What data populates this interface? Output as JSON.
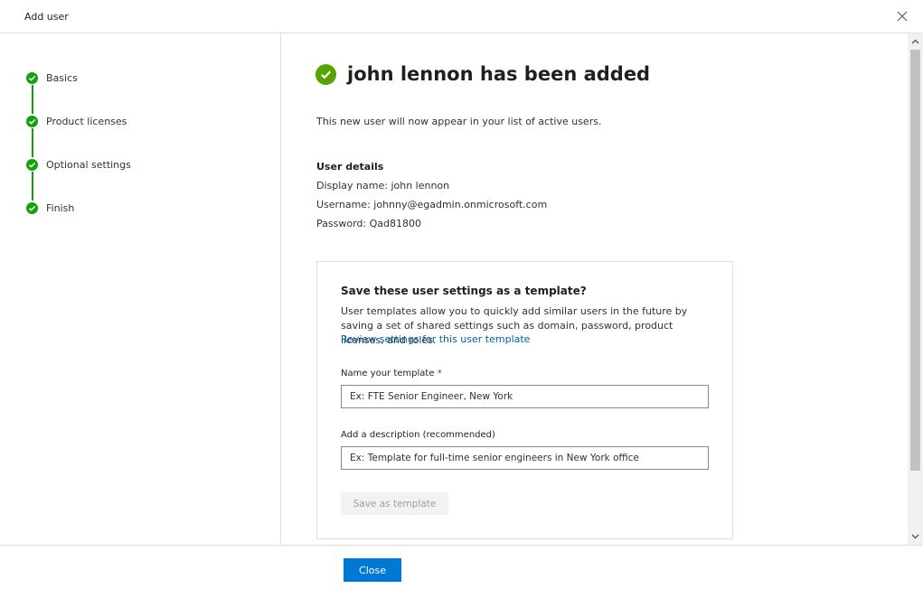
{
  "window": {
    "title": "Add user"
  },
  "steps": [
    {
      "label": "Basics"
    },
    {
      "label": "Product licenses"
    },
    {
      "label": "Optional settings"
    },
    {
      "label": "Finish"
    }
  ],
  "main": {
    "heading": "john lennon has been added",
    "intro": "This new user will now appear in your list of active users.",
    "details_title": "User details",
    "details": [
      "Display name: john lennon",
      "Username: johnny@egadmin.onmicrosoft.com",
      "Password: Qad81800"
    ]
  },
  "template_card": {
    "title": "Save these user settings as a template?",
    "body": "User templates allow you to quickly add similar users in the future by saving a set of shared settings such as domain, password, product licenses, and roles.",
    "link": "Review settings for this user template",
    "name_label": "Name your template",
    "required_mark": "*",
    "name_placeholder": "Ex: FTE Senior Engineer, New York",
    "desc_label": "Add a description (recommended)",
    "desc_placeholder": "Ex: Template for full-time senior engineers in New York office",
    "save_button": "Save as template"
  },
  "footer": {
    "close_button": "Close"
  },
  "colors": {
    "step_complete": "#13a10e",
    "success_check": "#57a300",
    "primary_button": "#0078d4",
    "link": "#0062a8"
  },
  "icons": [
    "close-icon",
    "checkmark-icon",
    "chevron-up-icon",
    "chevron-down-icon"
  ]
}
